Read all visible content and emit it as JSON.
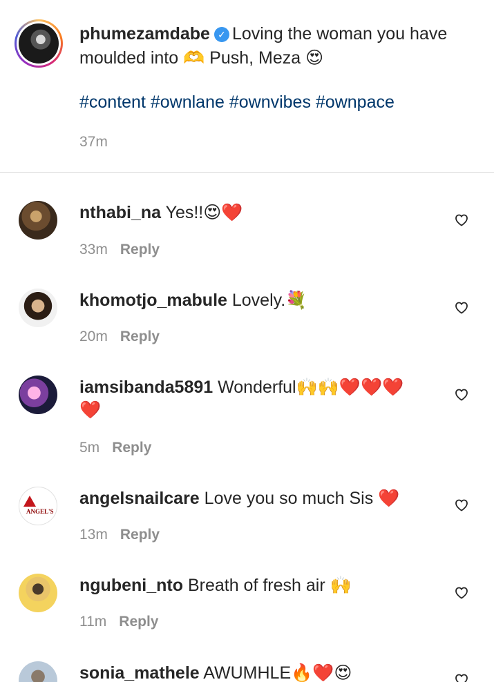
{
  "caption": {
    "username": "phumezamdabe",
    "verified_badge": "✓",
    "text": "Loving the woman you have moulded into 🫶 Push, Meza 😍",
    "hashtags": "#content #ownlane #ownvibes #ownpace",
    "time": "37m"
  },
  "reply_label": "Reply",
  "comments": [
    {
      "username": "nthabi_na",
      "text": "Yes!!😍❤️",
      "time": "33m"
    },
    {
      "username": "khomotjo_mabule",
      "text": "Lovely.💐",
      "time": "20m"
    },
    {
      "username": "iamsibanda5891",
      "text": "Wonderful🙌🙌❤️❤️❤️❤️",
      "time": "5m"
    },
    {
      "username": "angelsnailcare",
      "text": "Love you so much Sis ❤️",
      "time": "13m",
      "logo_text": "ANGEL'S"
    },
    {
      "username": "ngubeni_nto",
      "text": "Breath of fresh air 🙌",
      "time": "11m"
    },
    {
      "username": "sonia_mathele",
      "text": "AWUMHLE🔥❤️😍",
      "time": ""
    }
  ],
  "colors": {
    "link": "#00376b",
    "muted": "#8e8e8e",
    "verified": "#3897f0",
    "divider": "#dbdbdb"
  }
}
